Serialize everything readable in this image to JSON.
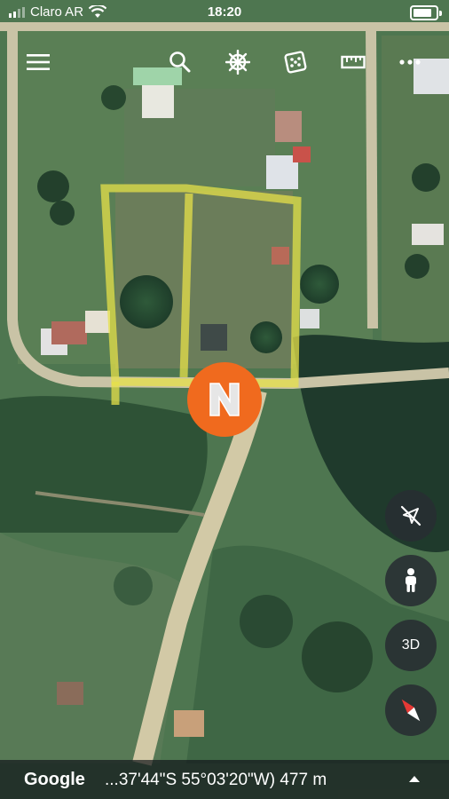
{
  "status_bar": {
    "carrier": "Claro AR",
    "time": "18:20"
  },
  "toolbar": {
    "icons": [
      "menu-icon",
      "search-icon",
      "voyager-wheel-icon",
      "dice-icon",
      "ruler-icon",
      "more-icon"
    ]
  },
  "map": {
    "marker_letter": "N",
    "marker_color": "#f06a1e",
    "parcel_outline_color": "#e6e04a"
  },
  "controls": {
    "threed_label": "3D",
    "icons": [
      "location-off-icon",
      "pegman-icon",
      "compass-icon"
    ]
  },
  "bottom_bar": {
    "brand": "Google",
    "coordinates": "...37'44\"S 55°03'20\"W) 477 m"
  }
}
